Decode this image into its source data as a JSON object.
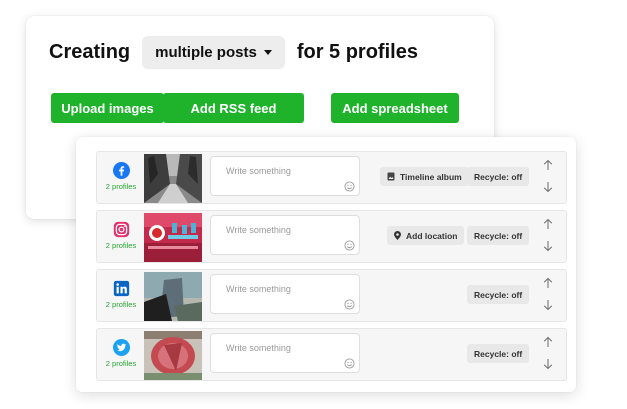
{
  "header": {
    "creating_label": "Creating",
    "mode_selected": "multiple posts",
    "for_label": "for 5 profiles"
  },
  "actions": {
    "upload_images": "Upload images",
    "add_rss_feed": "Add RSS feed",
    "add_spreadsheet": "Add spreadsheet"
  },
  "colors": {
    "accent_green": "#1fb32c",
    "facebook": "#1877f2",
    "instagram": "#e1306c",
    "linkedin": "#0a66c2",
    "twitter": "#1da1f2"
  },
  "rows": [
    {
      "network_icon": "facebook-icon",
      "profiles": "2 profiles",
      "placeholder": "Write something",
      "chips": [
        "Timeline album",
        "Recycle: off"
      ]
    },
    {
      "network_icon": "instagram-icon",
      "profiles": "2 profiles",
      "placeholder": "Write something",
      "chips": [
        "Add location",
        "Recycle: off"
      ]
    },
    {
      "network_icon": "linkedin-icon",
      "profiles": "2 profiles",
      "placeholder": "Write something",
      "chips": [
        "Recycle: off"
      ]
    },
    {
      "network_icon": "twitter-icon",
      "profiles": "2 profiles",
      "placeholder": "Write something",
      "chips": [
        "Recycle: off"
      ]
    }
  ]
}
